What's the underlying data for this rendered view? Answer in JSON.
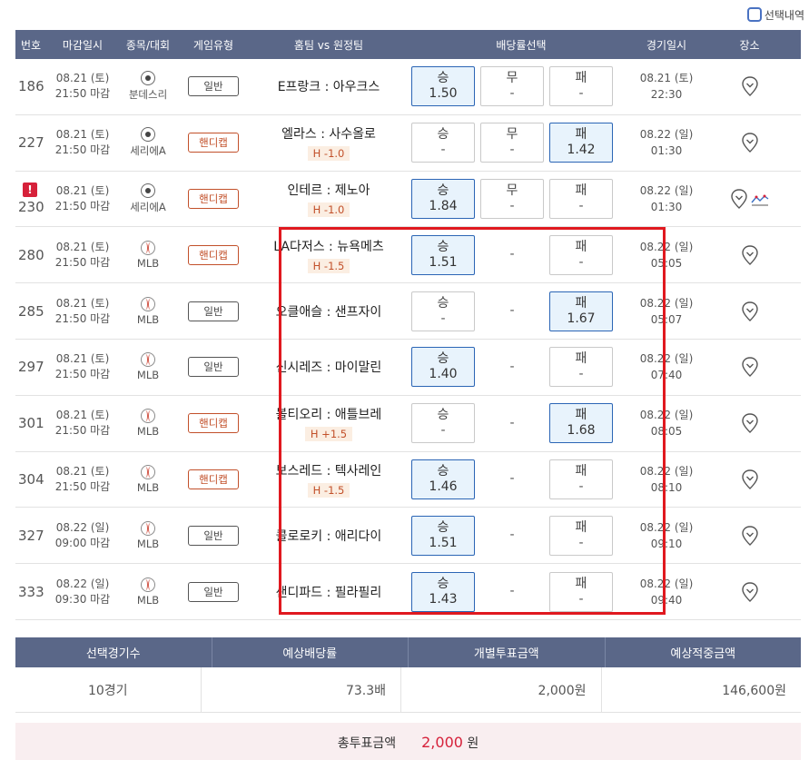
{
  "top": {
    "select_history_label": "선택내역"
  },
  "header": {
    "no": "번호",
    "deadline": "마감일시",
    "league": "종목/대회",
    "type": "게임유형",
    "teams": "홈팀 vs 원정팀",
    "odds": "배당률선택",
    "game_time": "경기일시",
    "place": "장소"
  },
  "rows": [
    {
      "no": "186",
      "alert": "",
      "deadline_date": "08.21 (토)",
      "deadline_time": "21:50 마감",
      "sport_icon": "soccer-icon",
      "league": "분데스리",
      "type": "일반",
      "handicap": false,
      "teams": "E프랑크 : 아우크스",
      "hc": "",
      "odds": [
        {
          "label": "승",
          "value": "1.50",
          "selected": true,
          "empty": false
        },
        {
          "label": "무",
          "value": "-",
          "selected": false,
          "empty": false
        },
        {
          "label": "패",
          "value": "-",
          "selected": false,
          "empty": false
        }
      ],
      "game_date": "08.21 (토)",
      "game_time": "22:30",
      "chart": false
    },
    {
      "no": "227",
      "alert": "",
      "deadline_date": "08.21 (토)",
      "deadline_time": "21:50 마감",
      "sport_icon": "soccer-icon",
      "league": "세리에A",
      "type": "핸디캡",
      "handicap": true,
      "teams": "엘라스 : 사수올로",
      "hc": "H -1.0",
      "odds": [
        {
          "label": "승",
          "value": "-",
          "selected": false,
          "empty": false
        },
        {
          "label": "무",
          "value": "-",
          "selected": false,
          "empty": false
        },
        {
          "label": "패",
          "value": "1.42",
          "selected": true,
          "empty": false
        }
      ],
      "game_date": "08.22 (일)",
      "game_time": "01:30",
      "chart": false
    },
    {
      "no": "230",
      "alert": "!",
      "deadline_date": "08.21 (토)",
      "deadline_time": "21:50 마감",
      "sport_icon": "soccer-icon",
      "league": "세리에A",
      "type": "핸디캡",
      "handicap": true,
      "teams": "인테르 : 제노아",
      "hc": "H -1.0",
      "odds": [
        {
          "label": "승",
          "value": "1.84",
          "selected": true,
          "empty": false
        },
        {
          "label": "무",
          "value": "-",
          "selected": false,
          "empty": false
        },
        {
          "label": "패",
          "value": "-",
          "selected": false,
          "empty": false
        }
      ],
      "game_date": "08.22 (일)",
      "game_time": "01:30",
      "chart": true
    },
    {
      "no": "280",
      "alert": "",
      "deadline_date": "08.21 (토)",
      "deadline_time": "21:50 마감",
      "sport_icon": "baseball-icon",
      "league": "MLB",
      "type": "핸디캡",
      "handicap": true,
      "teams": "LA다저스 : 뉴욕메츠",
      "hc": "H -1.5",
      "odds": [
        {
          "label": "승",
          "value": "1.51",
          "selected": true,
          "empty": false
        },
        {
          "label": "",
          "value": "-",
          "selected": false,
          "empty": true
        },
        {
          "label": "패",
          "value": "-",
          "selected": false,
          "empty": false
        }
      ],
      "game_date": "08.22 (일)",
      "game_time": "05:05",
      "chart": false
    },
    {
      "no": "285",
      "alert": "",
      "deadline_date": "08.21 (토)",
      "deadline_time": "21:50 마감",
      "sport_icon": "baseball-icon",
      "league": "MLB",
      "type": "일반",
      "handicap": false,
      "teams": "오클애슬 : 샌프자이",
      "hc": "",
      "odds": [
        {
          "label": "승",
          "value": "-",
          "selected": false,
          "empty": false
        },
        {
          "label": "",
          "value": "-",
          "selected": false,
          "empty": true
        },
        {
          "label": "패",
          "value": "1.67",
          "selected": true,
          "empty": false
        }
      ],
      "game_date": "08.22 (일)",
      "game_time": "05:07",
      "chart": false
    },
    {
      "no": "297",
      "alert": "",
      "deadline_date": "08.21 (토)",
      "deadline_time": "21:50 마감",
      "sport_icon": "baseball-icon",
      "league": "MLB",
      "type": "일반",
      "handicap": false,
      "teams": "신시레즈 : 마이말린",
      "hc": "",
      "odds": [
        {
          "label": "승",
          "value": "1.40",
          "selected": true,
          "empty": false
        },
        {
          "label": "",
          "value": "-",
          "selected": false,
          "empty": true
        },
        {
          "label": "패",
          "value": "-",
          "selected": false,
          "empty": false
        }
      ],
      "game_date": "08.22 (일)",
      "game_time": "07:40",
      "chart": false
    },
    {
      "no": "301",
      "alert": "",
      "deadline_date": "08.21 (토)",
      "deadline_time": "21:50 마감",
      "sport_icon": "baseball-icon",
      "league": "MLB",
      "type": "핸디캡",
      "handicap": true,
      "teams": "볼티오리 : 애틀브레",
      "hc": "H +1.5",
      "odds": [
        {
          "label": "승",
          "value": "-",
          "selected": false,
          "empty": false
        },
        {
          "label": "",
          "value": "-",
          "selected": false,
          "empty": true
        },
        {
          "label": "패",
          "value": "1.68",
          "selected": true,
          "empty": false
        }
      ],
      "game_date": "08.22 (일)",
      "game_time": "08:05",
      "chart": false
    },
    {
      "no": "304",
      "alert": "",
      "deadline_date": "08.21 (토)",
      "deadline_time": "21:50 마감",
      "sport_icon": "baseball-icon",
      "league": "MLB",
      "type": "핸디캡",
      "handicap": true,
      "teams": "보스레드 : 텍사레인",
      "hc": "H -1.5",
      "odds": [
        {
          "label": "승",
          "value": "1.46",
          "selected": true,
          "empty": false
        },
        {
          "label": "",
          "value": "-",
          "selected": false,
          "empty": true
        },
        {
          "label": "패",
          "value": "-",
          "selected": false,
          "empty": false
        }
      ],
      "game_date": "08.22 (일)",
      "game_time": "08:10",
      "chart": false
    },
    {
      "no": "327",
      "alert": "",
      "deadline_date": "08.22 (일)",
      "deadline_time": "09:00 마감",
      "sport_icon": "baseball-icon",
      "league": "MLB",
      "type": "일반",
      "handicap": false,
      "teams": "콜로로키 : 애리다이",
      "hc": "",
      "odds": [
        {
          "label": "승",
          "value": "1.51",
          "selected": true,
          "empty": false
        },
        {
          "label": "",
          "value": "-",
          "selected": false,
          "empty": true
        },
        {
          "label": "패",
          "value": "-",
          "selected": false,
          "empty": false
        }
      ],
      "game_date": "08.22 (일)",
      "game_time": "09:10",
      "chart": false
    },
    {
      "no": "333",
      "alert": "",
      "deadline_date": "08.22 (일)",
      "deadline_time": "09:30 마감",
      "sport_icon": "baseball-icon",
      "league": "MLB",
      "type": "일반",
      "handicap": false,
      "teams": "샌디파드 : 필라필리",
      "hc": "",
      "odds": [
        {
          "label": "승",
          "value": "1.43",
          "selected": true,
          "empty": false
        },
        {
          "label": "",
          "value": "-",
          "selected": false,
          "empty": true
        },
        {
          "label": "패",
          "value": "-",
          "selected": false,
          "empty": false
        }
      ],
      "game_date": "08.22 (일)",
      "game_time": "09:40",
      "chart": false
    }
  ],
  "summary": {
    "headers": [
      "선택경기수",
      "예상배당률",
      "개별투표금액",
      "예상적중금액"
    ],
    "values": [
      "10경기",
      "73.3배",
      "2,000원",
      "146,600원"
    ],
    "total_label": "총투표금액",
    "total_amount": "2,000",
    "total_unit": "원"
  },
  "colors": {
    "header_bg": "#5a6788",
    "selected_bg": "#e8f3fc",
    "selected_border": "#2b65b5",
    "handicap": "#c2502a",
    "highlight": "#e0191f",
    "alert": "#d6213a"
  }
}
